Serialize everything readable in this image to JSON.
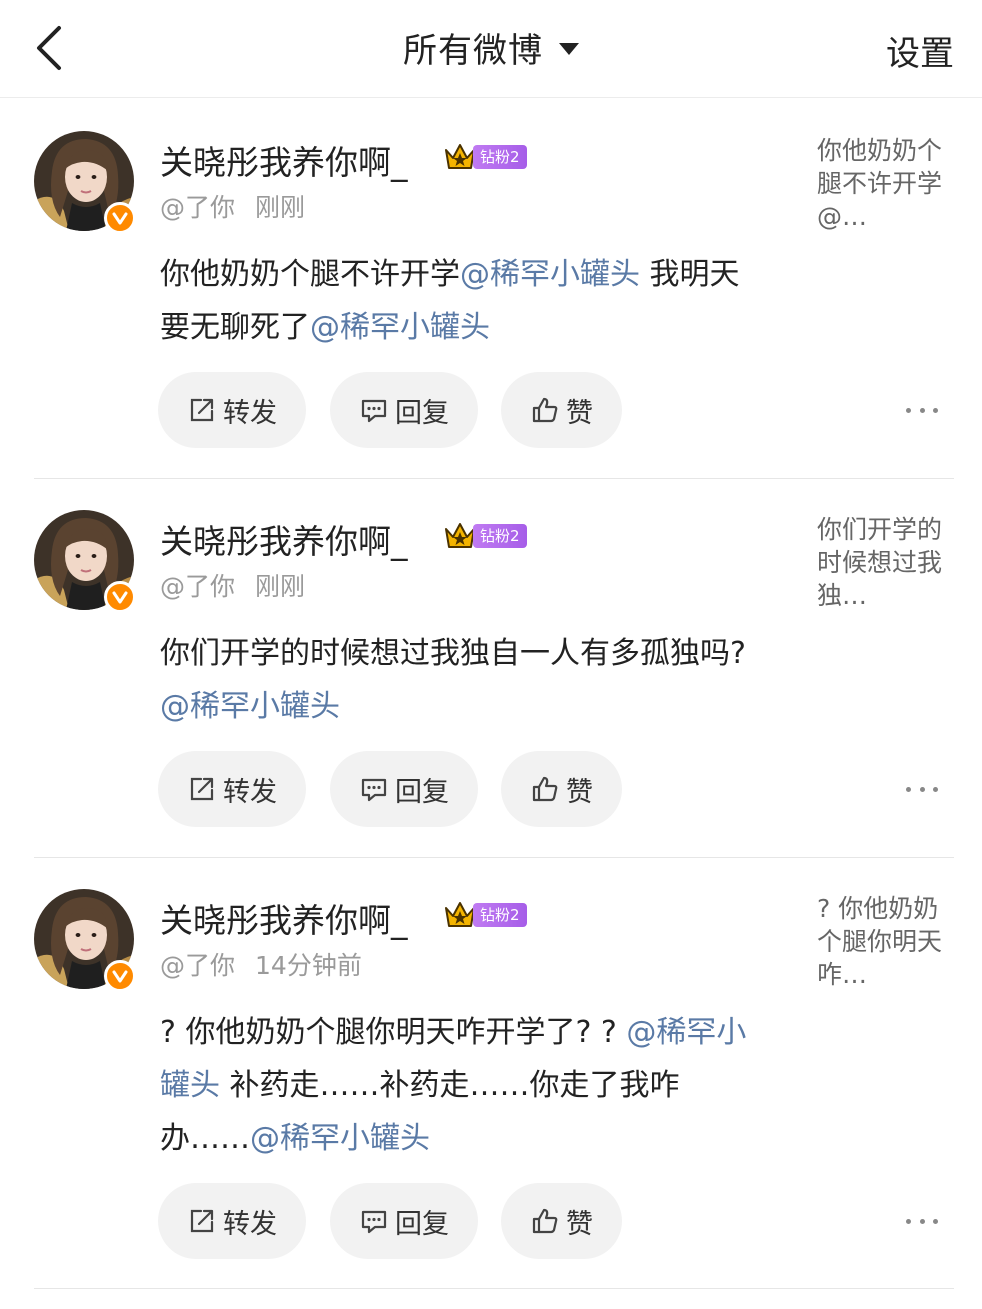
{
  "header": {
    "title": "所有微博",
    "settings_label": "设置"
  },
  "posts": [
    {
      "name": "关晓彤我养你啊_",
      "badge": "钻粉2",
      "handle": "@了你",
      "time": "刚刚",
      "body": [
        {
          "t": "你他奶奶个腿不许开学"
        },
        {
          "t": "@稀罕小罐头",
          "mention": true
        },
        {
          "t": " 我明天要无聊死了"
        },
        {
          "t": "@稀罕小罐头",
          "mention": true
        }
      ],
      "quote": "你他奶奶个腿不许开学@…",
      "actions": {
        "repost": "转发",
        "reply": "回复",
        "like": "赞"
      }
    },
    {
      "name": "关晓彤我养你啊_",
      "badge": "钻粉2",
      "handle": "@了你",
      "time": "刚刚",
      "body": [
        {
          "t": "你们开学的时候想过我独自一人有多孤独吗? "
        },
        {
          "t": "@稀罕小罐头",
          "mention": true
        }
      ],
      "quote": "你们开学的时候想过我独…",
      "actions": {
        "repost": "转发",
        "reply": "回复",
        "like": "赞"
      }
    },
    {
      "name": "关晓彤我养你啊_",
      "badge": "钻粉2",
      "handle": "@了你",
      "time": "14分钟前",
      "body": [
        {
          "t": "? 你他奶奶个腿你明天咋开学了? ? "
        },
        {
          "t": "@稀罕小罐头",
          "mention": true
        },
        {
          "t": " 补药走……补药走……你走了我咋办……"
        },
        {
          "t": "@稀罕小罐头",
          "mention": true
        }
      ],
      "quote": "? 你他奶奶个腿你明天咋…",
      "actions": {
        "repost": "转发",
        "reply": "回复",
        "like": "赞"
      }
    }
  ],
  "colors": {
    "mention": "#5a7aa6",
    "verified": "#ff8a00",
    "badge": "#b06ae9",
    "crown": "#f4b400",
    "button_bg": "#f2f2f2"
  },
  "icons": [
    "back-arrow-icon",
    "dropdown-caret-icon",
    "crown-icon",
    "verified-v-icon",
    "repost-icon",
    "comment-icon",
    "thumbs-up-icon",
    "more-dots-icon"
  ]
}
